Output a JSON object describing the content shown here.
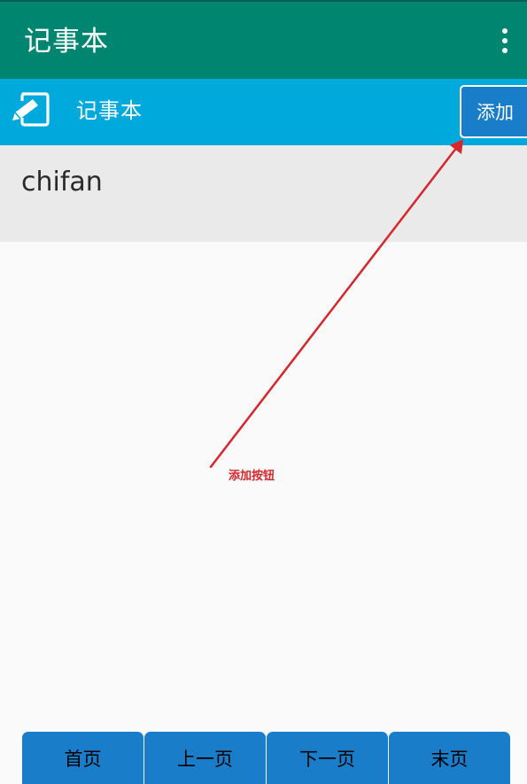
{
  "appbar": {
    "title": "记事本",
    "overflow_icon": "more-vert-icon",
    "background": "#008670"
  },
  "subbar": {
    "icon": "note-edit-icon",
    "title": "记事本",
    "add_label": "添加",
    "background": "#00a9dc"
  },
  "notes": [
    {
      "title": "chifan"
    }
  ],
  "annotation": {
    "label": "添加按钮",
    "color": "#d7262c"
  },
  "pager": {
    "first": "首页",
    "prev": "上一页",
    "next": "下一页",
    "last": "末页",
    "button_color": "#1a7dc9"
  }
}
